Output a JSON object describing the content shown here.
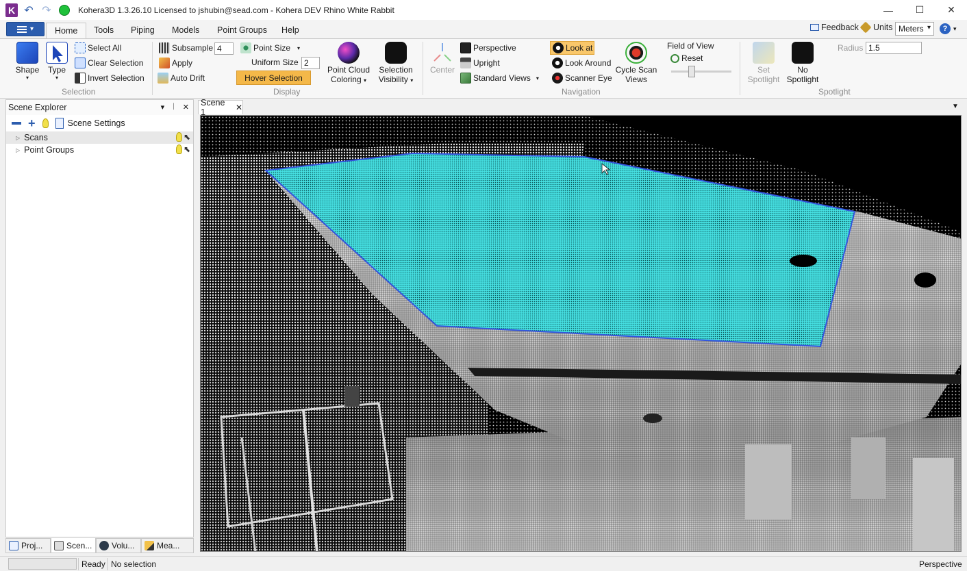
{
  "titlebar": {
    "title": "Kohera3D 1.3.26.10 Licensed to jshubin@sead.com - Kohera DEV Rhino White Rabbit",
    "logo_letter": "K",
    "undo_icon": "undo-icon",
    "redo_icon": "redo-icon",
    "status_dot_color": "#1fc13a",
    "minimize": "—",
    "maximize": "☐",
    "close": "✕"
  },
  "tabs": {
    "file_arrow": "▾",
    "items": [
      "Home",
      "Tools",
      "Piping",
      "Models",
      "Point Groups",
      "Help"
    ],
    "feedback": "Feedback",
    "units_label": "Units",
    "units_value": "Meters",
    "help": "?"
  },
  "ribbon": {
    "selection": {
      "shape": "Shape",
      "type": "Type",
      "select_all": "Select All",
      "clear_selection": "Clear Selection",
      "invert_selection": "Invert Selection",
      "group_label": "Selection"
    },
    "display": {
      "subsample": "Subsample",
      "subsample_value": "4",
      "apply": "Apply",
      "auto_drift": "Auto Drift",
      "point_size": "Point Size",
      "uniform_size": "Uniform Size",
      "uniform_size_value": "2",
      "hover_selection": "Hover Selection",
      "point_cloud_coloring_1": "Point Cloud",
      "point_cloud_coloring_2": "Coloring",
      "selection_visibility_1": "Selection",
      "selection_visibility_2": "Visibility",
      "group_label": "Display"
    },
    "navigation": {
      "center": "Center",
      "perspective": "Perspective",
      "upright": "Upright",
      "standard_views": "Standard Views",
      "look_at": "Look at",
      "look_around": "Look Around",
      "scanner_eye": "Scanner Eye",
      "cycle_scan_views_1": "Cycle Scan",
      "cycle_scan_views_2": "Views",
      "field_of_view": "Field of View",
      "reset": "Reset",
      "fov_level": 0.4,
      "group_label": "Navigation"
    },
    "spotlight": {
      "set_spotlight_1": "Set",
      "set_spotlight_2": "Spotlight",
      "no_spotlight_1": "No",
      "no_spotlight_2": "Spotlight",
      "radius_label": "Radius",
      "radius_value": "1.5",
      "group_label": "Spotlight"
    }
  },
  "explorer": {
    "title": "Scene Explorer",
    "pin": "▾",
    "pin2": "📌",
    "close": "✕",
    "scene_settings": "Scene Settings",
    "items": [
      {
        "label": "Scans"
      },
      {
        "label": "Point Groups"
      }
    ],
    "bottom_tabs": [
      "Proj...",
      "Scen...",
      "Volu...",
      "Mea..."
    ]
  },
  "scene": {
    "tab_label": "Scene 1",
    "tab_close": "✕",
    "selection_color": "#3fe3e6",
    "selection_outline": "#3355dd"
  },
  "status": {
    "ready": "Ready",
    "selection": "No selection",
    "view_mode": "Perspective"
  }
}
